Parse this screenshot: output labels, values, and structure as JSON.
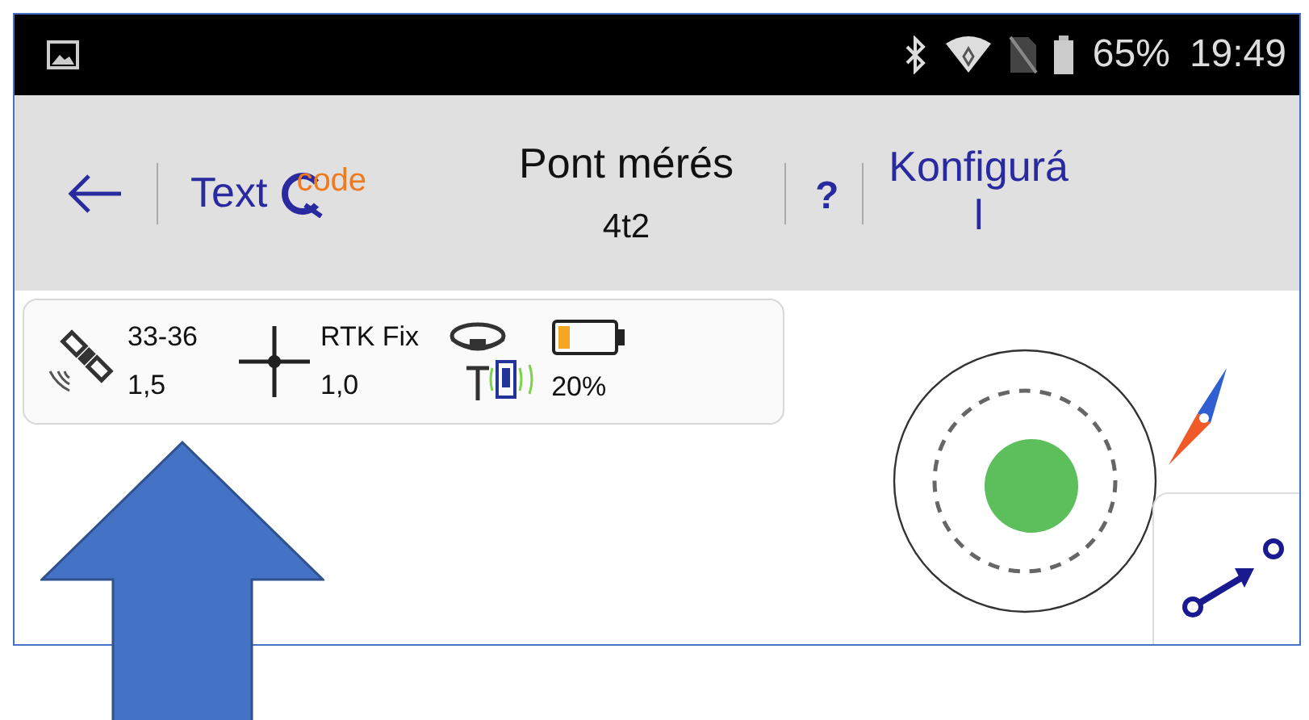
{
  "status_bar": {
    "battery": "65%",
    "time": "19:49"
  },
  "toolbar": {
    "app_name": "Text",
    "logo_text": "code",
    "title": "Pont mérés",
    "subtitle": "4t2",
    "help": "?",
    "config_lines": [
      "Konfigurá",
      "l"
    ]
  },
  "gnss_panel": {
    "satellites": "33-36",
    "satellite_value": "1,5",
    "fix": "RTK Fix",
    "fix_value": "1,0",
    "receiver_battery": "20%"
  }
}
